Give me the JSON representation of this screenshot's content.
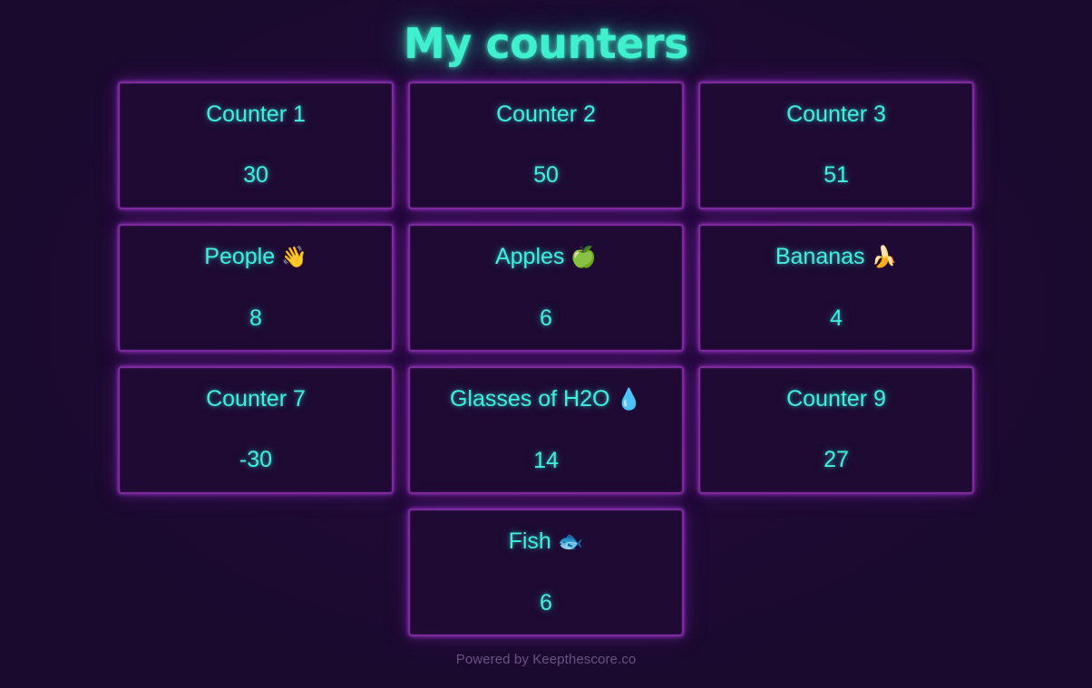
{
  "header": {
    "title": "My counters",
    "title_color": "#3ff0cd"
  },
  "theme": {
    "page_background": "#1a0a2e",
    "card_background": "#1e0a33",
    "card_border": "#7d2a9e",
    "accent_text": "#3ff0e0",
    "footer_text": "#6b5285"
  },
  "counters": [
    {
      "name": "Counter 1",
      "emoji": "",
      "value": "30"
    },
    {
      "name": "Counter 2",
      "emoji": "",
      "value": "50"
    },
    {
      "name": "Counter 3",
      "emoji": "",
      "value": "51"
    },
    {
      "name": "People",
      "emoji": "👋",
      "value": "8"
    },
    {
      "name": "Apples",
      "emoji": "🍏",
      "value": "6"
    },
    {
      "name": "Bananas",
      "emoji": "🍌",
      "value": "4"
    },
    {
      "name": "Counter 7",
      "emoji": "",
      "value": "-30"
    },
    {
      "name": "Glasses of H2O",
      "emoji": "💧",
      "value": "14"
    },
    {
      "name": "Counter 9",
      "emoji": "",
      "value": "27"
    },
    {
      "name": "Fish",
      "emoji": "🐟",
      "value": "6"
    }
  ],
  "footer": {
    "text": "Powered by Keepthescore.co"
  }
}
